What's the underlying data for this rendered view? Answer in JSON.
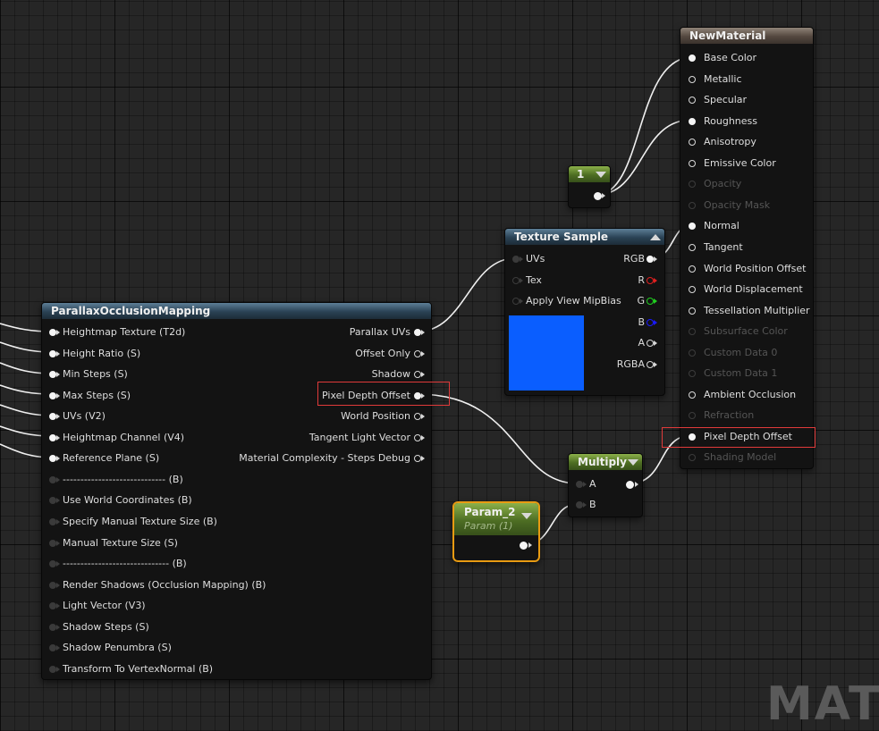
{
  "watermark": "MATE",
  "pom_node": {
    "title": "ParallaxOcclusionMapping",
    "inputs": [
      {
        "label": "Heightmap Texture (T2d)",
        "connected": true
      },
      {
        "label": "Height Ratio (S)",
        "connected": true
      },
      {
        "label": "Min Steps (S)",
        "connected": true
      },
      {
        "label": "Max Steps (S)",
        "connected": true
      },
      {
        "label": "UVs (V2)",
        "connected": true
      },
      {
        "label": "Heightmap Channel (V4)",
        "connected": true
      },
      {
        "label": "Reference Plane (S)",
        "connected": true
      },
      {
        "label": "----------------------------- (B)",
        "connected": false
      },
      {
        "label": "Use World Coordinates (B)",
        "connected": false
      },
      {
        "label": "Specify Manual Texture Size (B)",
        "connected": false
      },
      {
        "label": "Manual Texture Size (S)",
        "connected": false
      },
      {
        "label": "------------------------------ (B)",
        "connected": false
      },
      {
        "label": "Render Shadows (Occlusion Mapping) (B)",
        "connected": false
      },
      {
        "label": "Light Vector (V3)",
        "connected": false
      },
      {
        "label": "Shadow Steps (S)",
        "connected": false
      },
      {
        "label": "Shadow Penumbra (S)",
        "connected": false
      },
      {
        "label": "Transform To VertexNormal (B)",
        "connected": false
      }
    ],
    "outputs": [
      {
        "label": "Parallax UVs",
        "connected": true
      },
      {
        "label": "Offset Only",
        "connected": false
      },
      {
        "label": "Shadow",
        "connected": false
      },
      {
        "label": "Pixel Depth Offset",
        "connected": true
      },
      {
        "label": "World Position",
        "connected": false
      },
      {
        "label": "Tangent Light Vector",
        "connected": false
      },
      {
        "label": "Material Complexity - Steps Debug",
        "connected": false
      }
    ]
  },
  "texture_node": {
    "title": "Texture Sample",
    "inputs": [
      {
        "label": "UVs",
        "connected": true
      },
      {
        "label": "Tex",
        "connected": false
      },
      {
        "label": "Apply View MipBias",
        "connected": false
      }
    ],
    "outputs": [
      {
        "label": "RGB",
        "color": "#ffffff",
        "connected": true
      },
      {
        "label": "R",
        "color": "#e02020",
        "connected": false
      },
      {
        "label": "G",
        "color": "#20d020",
        "connected": false
      },
      {
        "label": "B",
        "color": "#1a1aff",
        "connected": false
      },
      {
        "label": "A",
        "color": "#d8d8d8",
        "connected": false
      },
      {
        "label": "RGBA",
        "color": "#d8d8d8",
        "connected": false
      }
    ],
    "preview_color": "#0a5eff"
  },
  "constant_node": {
    "title": "1"
  },
  "param_node": {
    "title": "Param_2",
    "subtitle": "Param (1)"
  },
  "multiply_node": {
    "title": "Multiply",
    "inputs": [
      {
        "label": "A"
      },
      {
        "label": "B"
      }
    ]
  },
  "material_node": {
    "title": "NewMaterial",
    "inputs": [
      {
        "label": "Base Color",
        "state": "connected"
      },
      {
        "label": "Metallic",
        "state": "active"
      },
      {
        "label": "Specular",
        "state": "active"
      },
      {
        "label": "Roughness",
        "state": "connected"
      },
      {
        "label": "Anisotropy",
        "state": "active"
      },
      {
        "label": "Emissive Color",
        "state": "active"
      },
      {
        "label": "Opacity",
        "state": "disabled"
      },
      {
        "label": "Opacity Mask",
        "state": "disabled"
      },
      {
        "label": "Normal",
        "state": "connected"
      },
      {
        "label": "Tangent",
        "state": "active"
      },
      {
        "label": "World Position Offset",
        "state": "active"
      },
      {
        "label": "World Displacement",
        "state": "active"
      },
      {
        "label": "Tessellation Multiplier",
        "state": "active"
      },
      {
        "label": "Subsurface Color",
        "state": "disabled"
      },
      {
        "label": "Custom Data 0",
        "state": "disabled"
      },
      {
        "label": "Custom Data 1",
        "state": "disabled"
      },
      {
        "label": "Ambient Occlusion",
        "state": "active"
      },
      {
        "label": "Refraction",
        "state": "disabled"
      },
      {
        "label": "Pixel Depth Offset",
        "state": "connected"
      },
      {
        "label": "Shading Model",
        "state": "disabled"
      }
    ]
  },
  "colors": {
    "graph_bg": "#262626",
    "node_body": "#131313",
    "highlight": "#e03a3a",
    "param_outline": "#e89b12",
    "wire": "#f0f0f0"
  }
}
